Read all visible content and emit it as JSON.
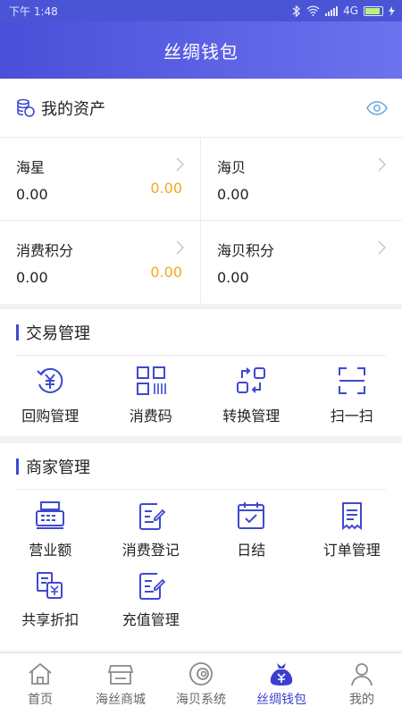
{
  "status_bar": {
    "time": "下午 1:48",
    "network": "4G"
  },
  "header": {
    "title": "丝绸钱包"
  },
  "assets": {
    "title": "我的资产",
    "items": [
      {
        "label": "海星",
        "value": "0.00",
        "value2": "0.00"
      },
      {
        "label": "海贝",
        "value": "0.00",
        "value2": ""
      },
      {
        "label": "消费积分",
        "value": "0.00",
        "value2": "0.00"
      },
      {
        "label": "海贝积分",
        "value": "0.00",
        "value2": ""
      }
    ]
  },
  "trade": {
    "title": "交易管理",
    "items": [
      {
        "label": "回购管理",
        "icon": "repurchase-icon"
      },
      {
        "label": "消费码",
        "icon": "qr-code-icon"
      },
      {
        "label": "转换管理",
        "icon": "convert-icon"
      },
      {
        "label": "扫一扫",
        "icon": "scan-icon"
      }
    ]
  },
  "merchant": {
    "title": "商家管理",
    "items": [
      {
        "label": "营业额",
        "icon": "cash-register-icon"
      },
      {
        "label": "消费登记",
        "icon": "edit-doc-icon"
      },
      {
        "label": "日结",
        "icon": "calendar-check-icon"
      },
      {
        "label": "订单管理",
        "icon": "order-doc-icon"
      },
      {
        "label": "共享折扣",
        "icon": "discount-icon"
      },
      {
        "label": "充值管理",
        "icon": "recharge-doc-icon"
      }
    ]
  },
  "tabbar": {
    "items": [
      {
        "label": "首页",
        "icon": "home-icon"
      },
      {
        "label": "海丝商城",
        "icon": "store-icon"
      },
      {
        "label": "海贝系统",
        "icon": "shell-icon"
      },
      {
        "label": "丝绸钱包",
        "icon": "wallet-bag-icon",
        "active": true
      },
      {
        "label": "我的",
        "icon": "user-icon"
      }
    ]
  },
  "colors": {
    "primary": "#4a4fd8",
    "accent_value": "#f5a623",
    "icon_blue": "#3e49d2"
  }
}
